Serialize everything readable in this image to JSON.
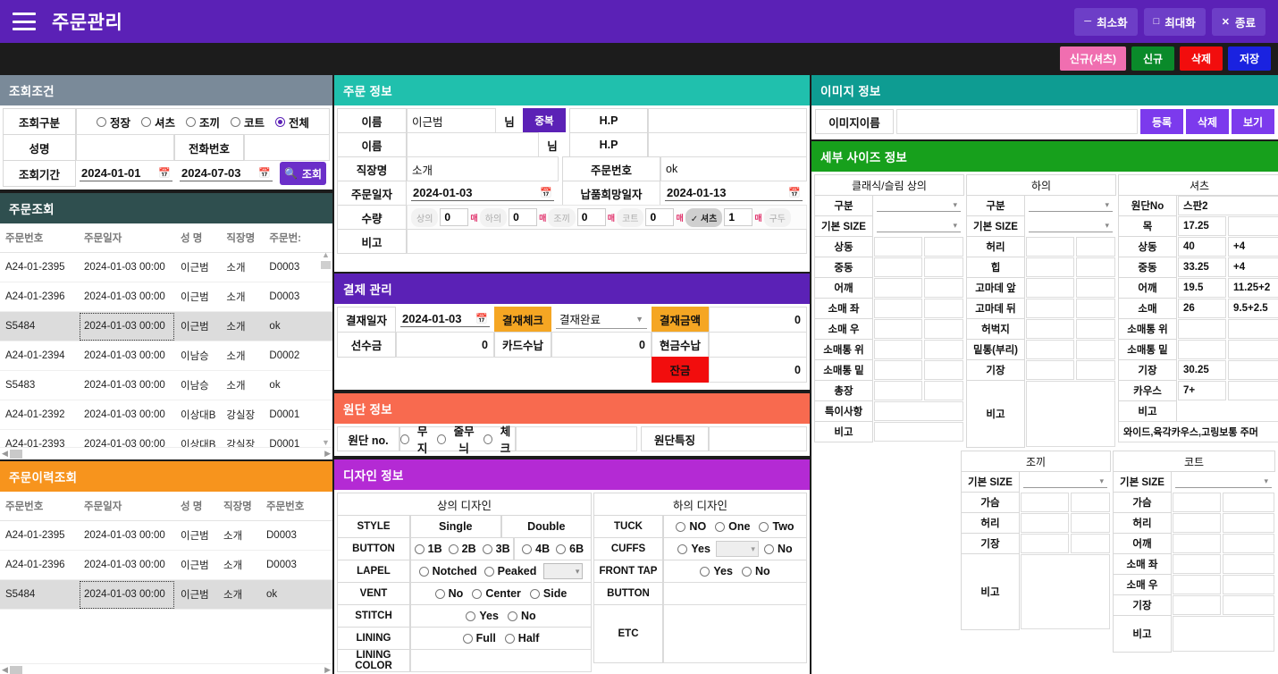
{
  "window": {
    "title": "주문관리",
    "minimize": "최소화",
    "maximize": "최대화",
    "close": "종료"
  },
  "toolbar": {
    "buttons": [
      {
        "label": "신규(셔츠)",
        "color": "#f06eb0"
      },
      {
        "label": "신규",
        "color": "#0a8a2a"
      },
      {
        "label": "삭제",
        "color": "#f20d0d"
      },
      {
        "label": "저장",
        "color": "#1a22e0"
      }
    ]
  },
  "search_panel": {
    "title": "조회조건",
    "header_color": "#7a8a99",
    "type_label": "조회구분",
    "type_options": [
      {
        "label": "정장",
        "selected": false
      },
      {
        "label": "셔츠",
        "selected": false
      },
      {
        "label": "조끼",
        "selected": false
      },
      {
        "label": "코트",
        "selected": false
      },
      {
        "label": "전체",
        "selected": true
      }
    ],
    "name_label": "성명",
    "name_value": "",
    "phone_label": "전화번호",
    "phone_value": "",
    "period_label": "조회기간",
    "date_from": "2024-01-01",
    "date_to": "2024-07-03",
    "search_button": "조회"
  },
  "order_list": {
    "title": "주문조회",
    "header_color": "#2f4f4f",
    "columns": [
      "주문번호",
      "주문일자",
      "성 명",
      "직장명",
      "주문번:"
    ],
    "rows": [
      {
        "cells": [
          "A24-01-2395",
          "2024-01-03 00:00",
          "이근범",
          "소개",
          "D0003"
        ],
        "selected": false
      },
      {
        "cells": [
          "A24-01-2396",
          "2024-01-03 00:00",
          "이근범",
          "소개",
          "D0003"
        ],
        "selected": false
      },
      {
        "cells": [
          "S5484",
          "2024-01-03 00:00",
          "이근범",
          "소개",
          "ok"
        ],
        "selected": true
      },
      {
        "cells": [
          "A24-01-2394",
          "2024-01-03 00:00",
          "이남승",
          "소개",
          "D0002"
        ],
        "selected": false
      },
      {
        "cells": [
          "S5483",
          "2024-01-03 00:00",
          "이남승",
          "소개",
          "ok"
        ],
        "selected": false
      },
      {
        "cells": [
          "A24-01-2392",
          "2024-01-03 00:00",
          "이상대B",
          "강실장",
          "D0001"
        ],
        "selected": false
      },
      {
        "cells": [
          "A24-01-2393",
          "2024-01-03 00:00",
          "이상대B",
          "강실장",
          "D0001"
        ],
        "selected": false
      }
    ]
  },
  "order_history": {
    "title": "주문이력조회",
    "header_color": "#f7941d",
    "columns": [
      "주문번호",
      "주문일자",
      "성 명",
      "직장명",
      "주문번호"
    ],
    "rows": [
      {
        "cells": [
          "A24-01-2395",
          "2024-01-03 00:00",
          "이근범",
          "소개",
          "D0003"
        ],
        "selected": false
      },
      {
        "cells": [
          "A24-01-2396",
          "2024-01-03 00:00",
          "이근범",
          "소개",
          "D0003"
        ],
        "selected": false
      },
      {
        "cells": [
          "S5484",
          "2024-01-03 00:00",
          "이근범",
          "소개",
          "ok"
        ],
        "selected": true
      }
    ]
  },
  "order_info": {
    "title": "주문 정보",
    "header_color": "#20c0ad",
    "name1_label": "이름",
    "name1_value": "이근범",
    "nim1": "님",
    "dup_button": "중복",
    "hp1_label": "H.P",
    "hp1_value": "",
    "name2_label": "이름",
    "name2_value": "",
    "nim2": "님",
    "hp2_label": "H.P",
    "hp2_value": "",
    "company_label": "직장명",
    "company_value": "소개",
    "orderno_label": "주문번호",
    "orderno_value": "ok",
    "orderdate_label": "주문일자",
    "orderdate_value": "2024-01-03",
    "duedate_label": "납품희망일자",
    "duedate_value": "2024-01-13",
    "qty_label": "수량",
    "qty_items": [
      {
        "name": "상의",
        "value": "0",
        "unit": "매",
        "active": false
      },
      {
        "name": "하의",
        "value": "0",
        "unit": "매",
        "active": false
      },
      {
        "name": "조끼",
        "value": "0",
        "unit": "매",
        "active": false
      },
      {
        "name": "코트",
        "value": "0",
        "unit": "매",
        "active": false
      },
      {
        "name": "셔츠",
        "value": "1",
        "unit": "매",
        "active": true
      }
    ],
    "qty_last": "구두",
    "memo_label": "비고",
    "memo_value": ""
  },
  "payment": {
    "title": "결제 관리",
    "header_color": "#5b21b6",
    "paydate_label": "결재일자",
    "paydate_value": "2024-01-03",
    "paycheck_button": "결재체크",
    "paystatus_value": "결재완료",
    "payamount_label": "결재금액",
    "payamount_value": "0",
    "prepay_label": "선수금",
    "prepay_value": "0",
    "card_label": "카드수납",
    "card_value": "0",
    "cash_label": "현금수납",
    "cash_value": "",
    "balance_label": "잔금",
    "balance_value": "0"
  },
  "fabric": {
    "title": "원단 정보",
    "header_color": "#f86a4f",
    "no_label": "원단 no.",
    "options": [
      {
        "label": "무지",
        "selected": false
      },
      {
        "label": "줄무늬",
        "selected": false
      },
      {
        "label": "체크",
        "selected": false
      }
    ],
    "no_value": "",
    "feature_label": "원단특징",
    "feature_value": ""
  },
  "design": {
    "title": "디자인 정보",
    "header_color": "#b42ad4",
    "top_header": "상의 디자인",
    "bottom_header": "하의 디자인",
    "top_rows": [
      {
        "label": "STYLE",
        "type": "two",
        "a": "Single",
        "b": "Double"
      },
      {
        "label": "BUTTON",
        "type": "radio_split",
        "a": [
          {
            "label": "1B"
          },
          {
            "label": "2B"
          },
          {
            "label": "3B"
          }
        ],
        "b": [
          {
            "label": "4B"
          },
          {
            "label": "6B"
          }
        ]
      },
      {
        "label": "LAPEL",
        "type": "radio_sel",
        "a": [
          {
            "label": "Notched"
          },
          {
            "label": "Peaked"
          }
        ],
        "sel": ""
      },
      {
        "label": "VENT",
        "type": "radio",
        "a": [
          {
            "label": "No"
          },
          {
            "label": "Center"
          },
          {
            "label": "Side"
          }
        ]
      },
      {
        "label": "STITCH",
        "type": "radio",
        "a": [
          {
            "label": "Yes"
          },
          {
            "label": "No"
          }
        ]
      },
      {
        "label": "LINING",
        "type": "radio",
        "a": [
          {
            "label": "Full"
          },
          {
            "label": "Half"
          }
        ]
      },
      {
        "label": "LINING COLOR",
        "type": "input",
        "value": ""
      }
    ],
    "bottom_rows": [
      {
        "label": "TUCK",
        "type": "radio",
        "a": [
          {
            "label": "NO"
          },
          {
            "label": "One"
          },
          {
            "label": "Two"
          }
        ]
      },
      {
        "label": "CUFFS",
        "type": "radio_mid",
        "a": [
          {
            "label": "Yes"
          }
        ],
        "b": [
          {
            "label": "No"
          }
        ],
        "sel": ""
      },
      {
        "label": "FRONT TAP",
        "type": "radio",
        "a": [
          {
            "label": "Yes"
          },
          {
            "label": "No"
          }
        ]
      },
      {
        "label": "BUTTON",
        "type": "input",
        "value": ""
      },
      {
        "label": "ETC",
        "type": "textarea",
        "value": ""
      }
    ]
  },
  "image_info": {
    "title": "이미지 정보",
    "header_color": "#0e9c92",
    "name_label": "이미지이름",
    "name_value": "",
    "buttons": [
      "등록",
      "삭제",
      "보기"
    ]
  },
  "size_info": {
    "title": "세부 사이즈 정보",
    "header_color": "#17a01c",
    "jacket": {
      "header": "클래식/슬림 상의",
      "gubun_label": "구분",
      "gubun_value": "",
      "size_label": "기본 SIZE",
      "size_value": "",
      "rows": [
        {
          "label": "상동",
          "v1": "",
          "v2": ""
        },
        {
          "label": "중동",
          "v1": "",
          "v2": ""
        },
        {
          "label": "어깨",
          "v1": "",
          "v2": ""
        },
        {
          "label": "소매 좌",
          "v1": "",
          "v2": ""
        },
        {
          "label": "소매 우",
          "v1": "",
          "v2": ""
        },
        {
          "label": "소매통 위",
          "v1": "",
          "v2": ""
        },
        {
          "label": "소매통 밑",
          "v1": "",
          "v2": ""
        },
        {
          "label": "총장",
          "v1": "",
          "v2": ""
        }
      ],
      "special_label": "특이사항",
      "special_value": "",
      "memo_label": "비고",
      "memo_value": ""
    },
    "pants": {
      "header": "하의",
      "gubun_label": "구분",
      "gubun_value": "",
      "size_label": "기본 SIZE",
      "size_value": "",
      "rows": [
        {
          "label": "허리",
          "v1": "",
          "v2": ""
        },
        {
          "label": "힙",
          "v1": "",
          "v2": ""
        },
        {
          "label": "고마데 앞",
          "v1": "",
          "v2": ""
        },
        {
          "label": "고마데 뒤",
          "v1": "",
          "v2": ""
        },
        {
          "label": "허벅지",
          "v1": "",
          "v2": ""
        },
        {
          "label": "밑통(부리)",
          "v1": "",
          "v2": ""
        },
        {
          "label": "기장",
          "v1": "",
          "v2": ""
        }
      ],
      "memo_label": "비고",
      "memo_value": ""
    },
    "shirt": {
      "header": "셔츠",
      "fabric_label": "원단No",
      "fabric_value": "스판2",
      "rows": [
        {
          "label": "목",
          "v1": "17.25",
          "v2": ""
        },
        {
          "label": "상동",
          "v1": "40",
          "v2": "+4"
        },
        {
          "label": "중동",
          "v1": "33.25",
          "v2": "+4"
        },
        {
          "label": "어깨",
          "v1": "19.5",
          "v2": "11.25+2"
        },
        {
          "label": "소매",
          "v1": "26",
          "v2": "9.5+2.5"
        },
        {
          "label": "소매통 위",
          "v1": "",
          "v2": ""
        },
        {
          "label": "소매통 밑",
          "v1": "",
          "v2": ""
        },
        {
          "label": "기장",
          "v1": "30.25",
          "v2": ""
        },
        {
          "label": "카우스",
          "v1": "7+",
          "v2": ""
        }
      ],
      "memo_label": "비고",
      "memo_value": "와이드,육각카우스,고링보통 주머"
    },
    "vest": {
      "header": "조끼",
      "size_label": "기본 SIZE",
      "size_value": "",
      "rows": [
        {
          "label": "가슴",
          "v1": "",
          "v2": ""
        },
        {
          "label": "허리",
          "v1": "",
          "v2": ""
        },
        {
          "label": "기장",
          "v1": "",
          "v2": ""
        }
      ],
      "memo_label": "비고",
      "memo_value": ""
    },
    "coat": {
      "header": "코트",
      "size_label": "기본 SIZE",
      "size_value": "",
      "rows": [
        {
          "label": "가슴",
          "v1": "",
          "v2": ""
        },
        {
          "label": "허리",
          "v1": "",
          "v2": ""
        },
        {
          "label": "어깨",
          "v1": "",
          "v2": ""
        },
        {
          "label": "소매 좌",
          "v1": "",
          "v2": ""
        },
        {
          "label": "소매 우",
          "v1": "",
          "v2": ""
        },
        {
          "label": "기장",
          "v1": "",
          "v2": ""
        }
      ],
      "memo_label": "비고",
      "memo_value": ""
    }
  }
}
